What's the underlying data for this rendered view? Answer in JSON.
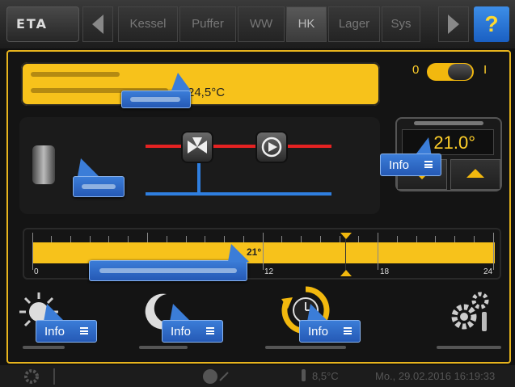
{
  "topbar": {
    "logo_text": "ETA",
    "tabs": [
      "Kessel",
      "Puffer",
      "WW",
      "HK",
      "Lager",
      "Sys"
    ],
    "active_tab": "HK",
    "help_label": "?"
  },
  "main": {
    "status_temp": "24,5°C",
    "toggle": {
      "off_label": "0",
      "on_label": "I",
      "state": "on"
    },
    "setpoint": {
      "value": "21.0°"
    },
    "timeline": {
      "current_temp": "21°",
      "hour_labels": [
        "0",
        "12",
        "18",
        "24"
      ]
    },
    "info_buttons": {
      "setpoint_info": "Info",
      "day_info": "Info",
      "night_info": "Info",
      "mode_info": "Info"
    }
  },
  "colors": {
    "accent": "#f7c21b",
    "info_blue": "#2f6fd0",
    "pipe_red": "#e52222",
    "pipe_blue": "#2f7fe0"
  },
  "statusbar": {
    "outdoor_temp": "8,5°C",
    "datetime": "Mo., 29.02.2016 16:19:33"
  }
}
